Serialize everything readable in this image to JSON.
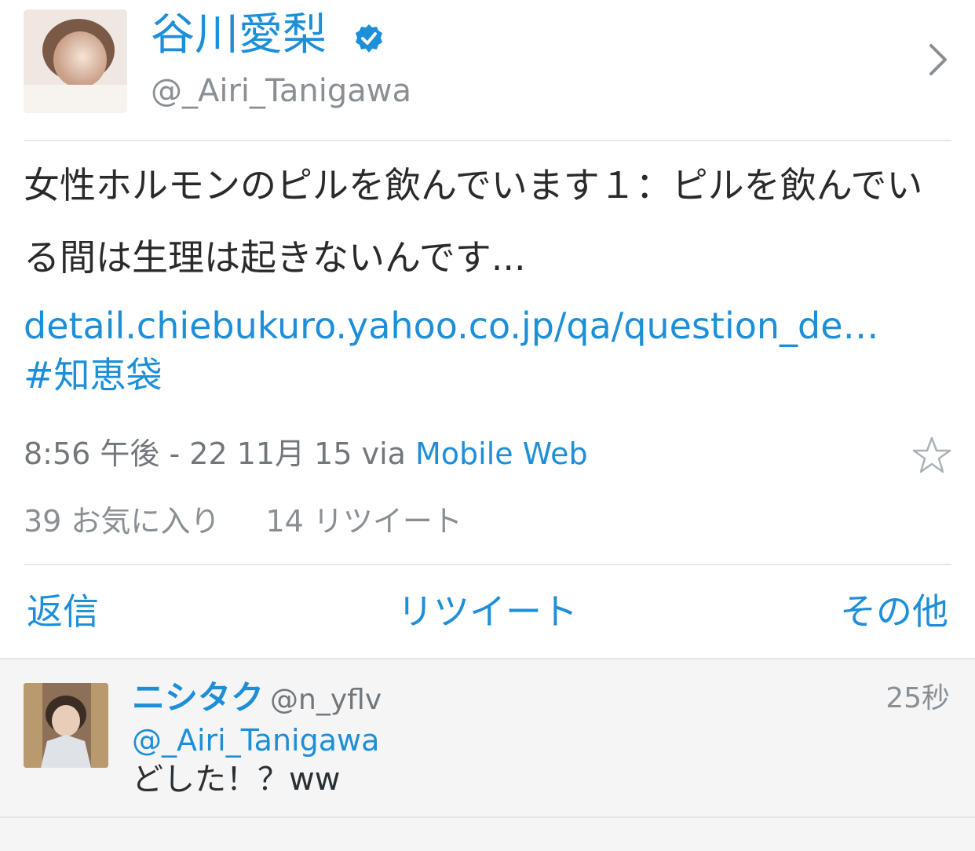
{
  "author": {
    "display_name": "谷川愛梨",
    "username": "@_Airi_Tanigawa",
    "verified": true,
    "avatar": "author-avatar-photo"
  },
  "tweet": {
    "text": "女性ホルモンのピルを飲んでいます１：ピルを飲んでいる間は生理は起きないんです...",
    "link": "detail.chiebukuro.yahoo.co.jp/qa/question_de…",
    "hashtag": "#知恵袋",
    "timestamp": "8:56 午後 - 22 11月 15 via ",
    "via": "Mobile Web"
  },
  "stats": {
    "favorites": "39 お気に入り",
    "retweets": "14 リツイート"
  },
  "actions": {
    "reply": "返信",
    "retweet": "リツイート",
    "more": "その他"
  },
  "reply": {
    "name": "ニシタク",
    "handle": "@n_yflv",
    "time": "25秒",
    "mention": "@_Airi_Tanigawa",
    "text": "どした！？ww"
  },
  "colors": {
    "accent": "#1d8fd8",
    "muted": "#8a8f94",
    "separator": "#e4e7ea"
  },
  "icons": [
    "verified-badge-icon",
    "chevron-right-icon",
    "star-icon"
  ]
}
